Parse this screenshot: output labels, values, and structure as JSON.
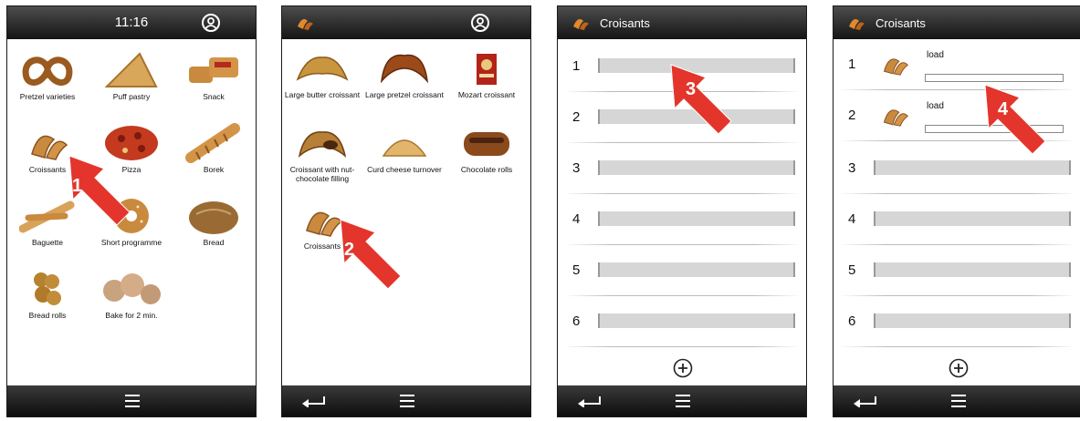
{
  "screen1": {
    "time": "11:16",
    "products": [
      {
        "label": "Pretzel varieties",
        "icon": "pretzel-icon"
      },
      {
        "label": "Puff pastry",
        "icon": "puff-pastry-icon"
      },
      {
        "label": "Snack",
        "icon": "snack-icon"
      },
      {
        "label": "Croissants",
        "icon": "croissant-icon"
      },
      {
        "label": "Pizza",
        "icon": "pizza-icon"
      },
      {
        "label": "Borek",
        "icon": "borek-icon"
      },
      {
        "label": "Baguette",
        "icon": "baguette-icon"
      },
      {
        "label": "Short programme",
        "icon": "bagel-icon"
      },
      {
        "label": "Bread",
        "icon": "bread-icon"
      },
      {
        "label": "Bread rolls",
        "icon": "bread-rolls-icon"
      },
      {
        "label": "Bake for 2 min.",
        "icon": "rolls-icon"
      }
    ],
    "step": "1"
  },
  "screen2": {
    "products": [
      {
        "label": "Large butter croissant",
        "icon": "croissant-icon"
      },
      {
        "label": "Large pretzel croissant",
        "icon": "croissant-icon"
      },
      {
        "label": "Mozart croissant",
        "icon": "mozart-box-icon"
      },
      {
        "label": "Croissant with nut-chocolate filling",
        "icon": "croissant-icon"
      },
      {
        "label": "Curd cheese turnover",
        "icon": "turnover-icon"
      },
      {
        "label": "Chocolate rolls",
        "icon": "chocolate-roll-icon"
      },
      {
        "label": "Croissants",
        "icon": "croissant-icon"
      }
    ],
    "step": "2"
  },
  "screen3": {
    "title": "Croisants",
    "slots": [
      "1",
      "2",
      "3",
      "4",
      "5",
      "6"
    ],
    "step": "3"
  },
  "screen4": {
    "title": "Croisants",
    "slots": [
      "1",
      "2",
      "3",
      "4",
      "5",
      "6"
    ],
    "loaded_text": "load",
    "step": "4"
  },
  "colors": {
    "bar_dark": "#141414",
    "arrow_red": "#e3352b",
    "slot_fill": "#d6d6d6"
  }
}
